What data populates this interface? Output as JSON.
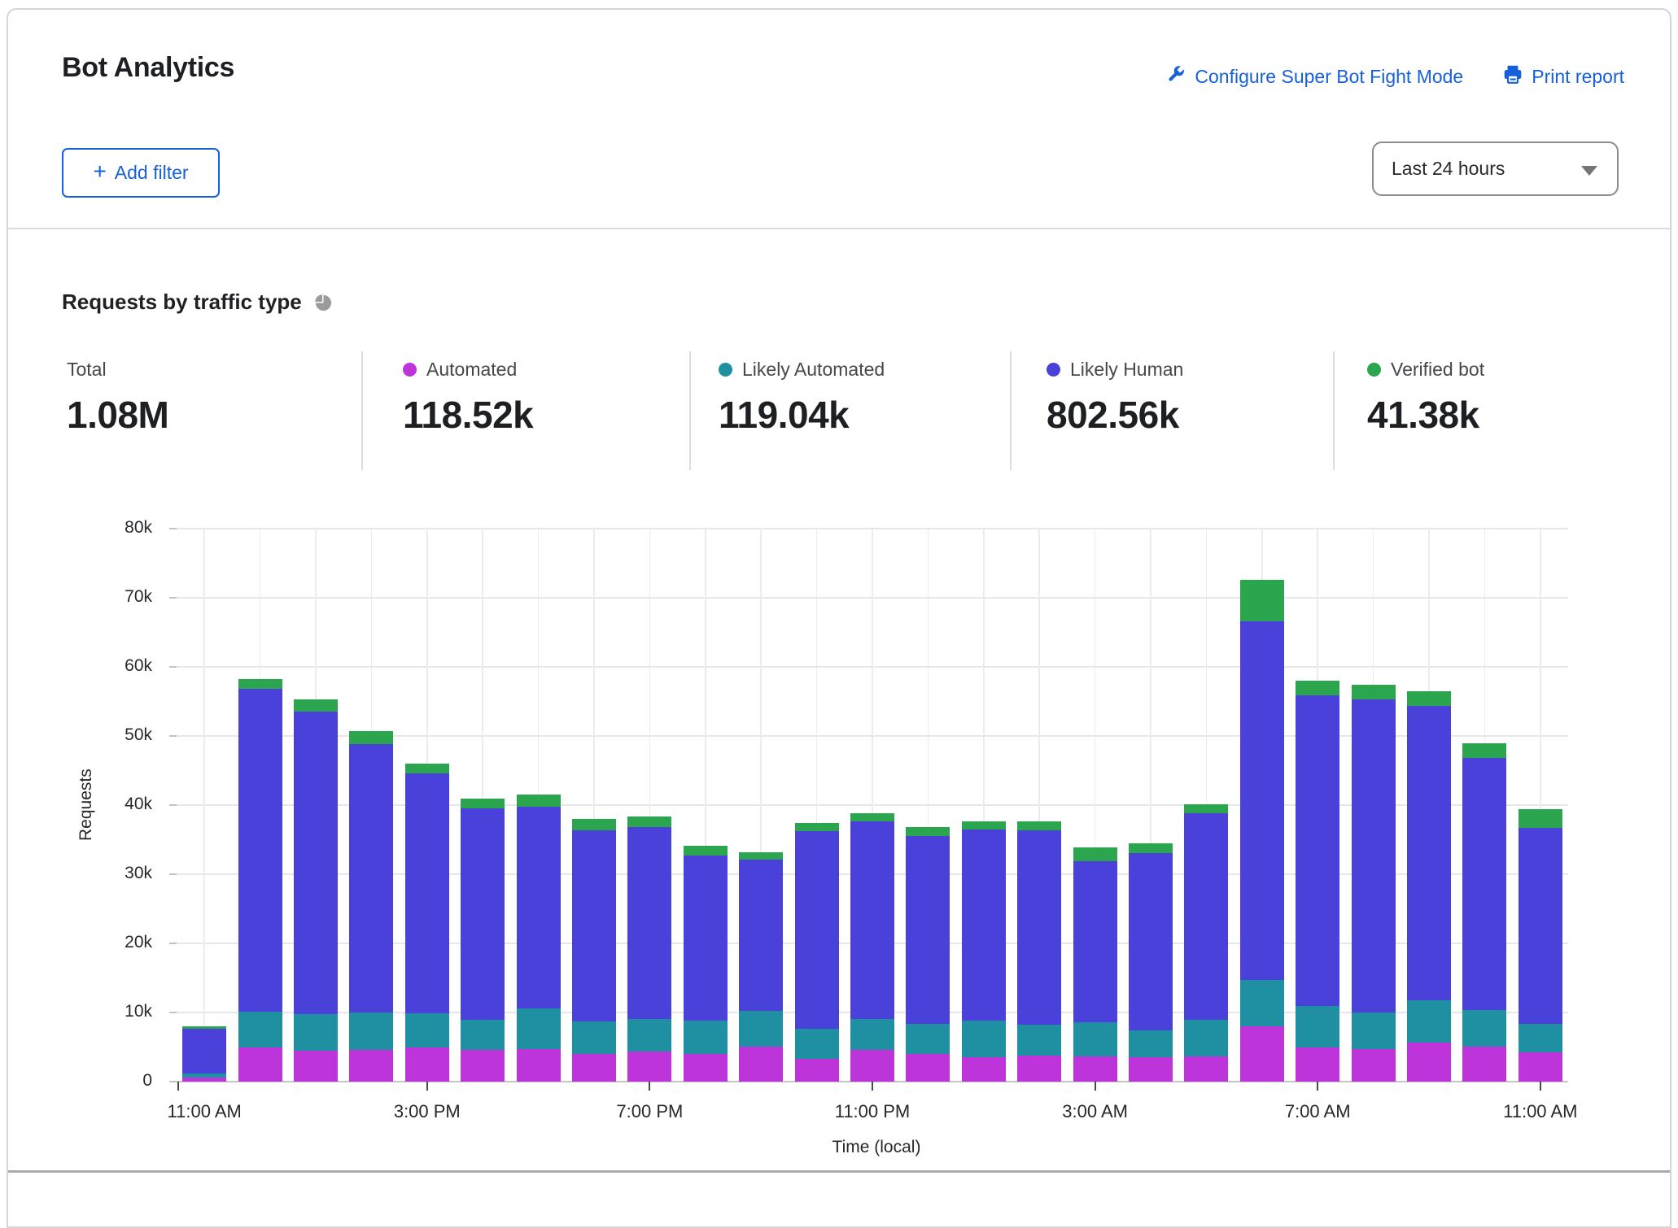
{
  "header": {
    "title": "Bot Analytics",
    "configure_link": "Configure Super Bot Fight Mode",
    "print_link": "Print report",
    "add_filter_plus": "+",
    "add_filter_label": "Add filter",
    "time_range": "Last 24 hours"
  },
  "section": {
    "title": "Requests by traffic type"
  },
  "stats": [
    {
      "label": "Total",
      "value": "1.08M",
      "color": null
    },
    {
      "label": "Automated",
      "value": "118.52k",
      "color": "#bc34da"
    },
    {
      "label": "Likely Automated",
      "value": "119.04k",
      "color": "#1f8fa2"
    },
    {
      "label": "Likely Human",
      "value": "802.56k",
      "color": "#4a41da"
    },
    {
      "label": "Verified bot",
      "value": "41.38k",
      "color": "#2ca64e"
    }
  ],
  "chart_data": {
    "type": "bar",
    "stacked": true,
    "title": "Requests by traffic type",
    "xlabel": "Time (local)",
    "ylabel": "Requests",
    "values_unit": "thousands of requests per hour",
    "ylim_k": [
      0,
      80
    ],
    "grid": true,
    "y_ticks": [
      "0",
      "10k",
      "20k",
      "30k",
      "40k",
      "50k",
      "60k",
      "70k",
      "80k"
    ],
    "x_tick_labels": [
      "11:00 AM",
      "3:00 PM",
      "7:00 PM",
      "11:00 PM",
      "3:00 AM",
      "7:00 AM",
      "11:00 AM"
    ],
    "x_tick_indices": [
      0,
      4,
      8,
      12,
      16,
      20,
      24
    ],
    "series": [
      {
        "name": "Automated",
        "color": "#bc34da",
        "values": [
          0.6,
          4.9,
          4.5,
          4.6,
          4.9,
          4.6,
          4.7,
          4.0,
          4.4,
          4.0,
          5.1,
          3.3,
          4.6,
          4.0,
          3.5,
          3.8,
          3.6,
          3.5,
          3.6,
          8.0,
          4.9,
          4.7,
          5.7,
          5.1,
          4.2
        ]
      },
      {
        "name": "Likely Automated",
        "color": "#1f8fa2",
        "values": [
          0.6,
          5.2,
          5.3,
          5.4,
          5.0,
          4.3,
          5.9,
          4.7,
          4.7,
          4.8,
          5.1,
          4.4,
          4.5,
          4.3,
          5.3,
          4.4,
          5.0,
          3.9,
          5.4,
          6.7,
          6.1,
          5.3,
          6.1,
          5.2,
          4.2
        ]
      },
      {
        "name": "Likely Human",
        "color": "#4a41da",
        "values": [
          6.5,
          46.7,
          43.7,
          38.8,
          34.7,
          30.6,
          29.2,
          27.7,
          27.7,
          23.9,
          21.9,
          28.5,
          28.5,
          27.2,
          27.7,
          28.2,
          23.3,
          25.7,
          29.8,
          51.9,
          44.9,
          45.3,
          42.6,
          36.5,
          28.3
        ]
      },
      {
        "name": "Verified bot",
        "color": "#2ca64e",
        "values": [
          0.3,
          1.4,
          1.8,
          1.9,
          1.4,
          1.5,
          1.7,
          1.6,
          1.6,
          1.4,
          1.1,
          1.2,
          1.2,
          1.3,
          1.2,
          1.3,
          2.0,
          1.4,
          1.3,
          6.0,
          2.1,
          2.1,
          2.1,
          2.2,
          2.7
        ]
      }
    ],
    "bar_totals_k": [
      8.0,
      58.2,
      55.3,
      50.7,
      46.0,
      41.0,
      41.5,
      38.0,
      38.4,
      34.1,
      33.2,
      37.4,
      38.8,
      36.8,
      37.7,
      37.7,
      33.9,
      34.5,
      40.1,
      72.6,
      58.0,
      57.4,
      56.5,
      49.0,
      39.4
    ]
  }
}
